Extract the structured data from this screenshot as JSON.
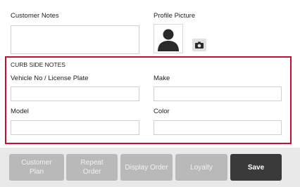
{
  "customer_notes": {
    "label": "Customer Notes",
    "value": ""
  },
  "profile_picture": {
    "label": "Profile Picture",
    "avatar_icon": "user-silhouette-icon",
    "camera_icon": "camera-icon"
  },
  "curbside": {
    "title": "CURB SIDE NOTES",
    "vehicle": {
      "label": "Vehicle No / License Plate",
      "value": ""
    },
    "make": {
      "label": "Make",
      "value": ""
    },
    "model": {
      "label": "Model",
      "value": ""
    },
    "color": {
      "label": "Color",
      "value": ""
    }
  },
  "buttons": {
    "customer_plan": "Customer\nPlan",
    "repeat_order": "Repeat\nOrder",
    "display_order": "Display Order",
    "loyalty": "Loyalty",
    "save": "Save"
  },
  "colors": {
    "accent_border": "#c8102e",
    "save_bg": "#3a3a3a",
    "disabled_bg": "#b9b9b9"
  }
}
